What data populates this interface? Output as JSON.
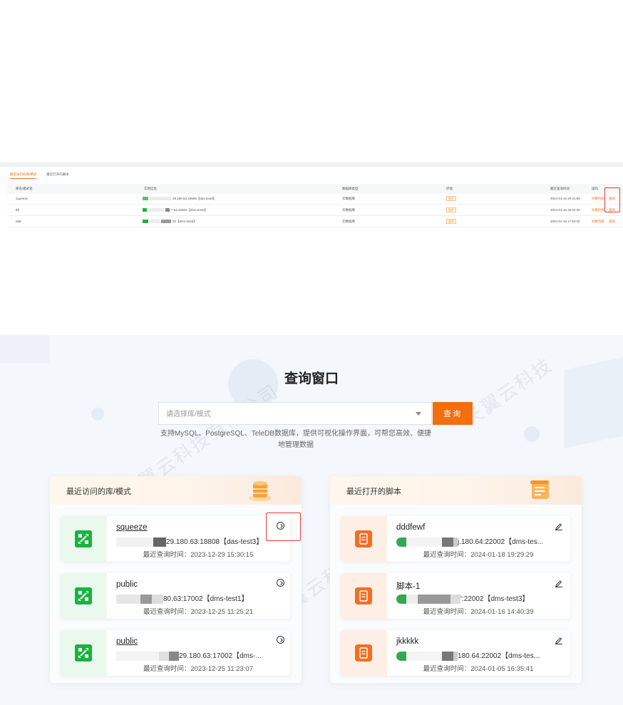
{
  "top_table": {
    "tabs": [
      "最近访问的库/模式",
      "最近打开的脚本"
    ],
    "columns": [
      "库名/模式名",
      "实例信息",
      "数据库类型",
      "环境",
      "最近查询时间",
      "操作"
    ],
    "rows": [
      {
        "name": "squeeze",
        "instance": "29.180.63:18808【das-test3】",
        "db_type": "云数据库",
        "env": "生产",
        "time": "2024-01-16 20:41:59",
        "op1": "对象列表",
        "op2": "查询"
      },
      {
        "name": "tttt",
        "instance": "7.64:22002【dms-test3】",
        "db_type": "云数据库",
        "env": "生产",
        "time": "2024-01-16 20:02:30",
        "op1": "对象列表",
        "op2": "查询"
      },
      {
        "name": "ddd",
        "instance": "02【dms-test3】",
        "db_type": "云数据库",
        "env": "生产",
        "time": "2024-01-16 17:54:30",
        "op1": "对象列表",
        "op2": "查询"
      }
    ]
  },
  "query": {
    "title": "查询窗口",
    "placeholder": "请选择库/模式",
    "button": "查询",
    "description": "支持MySQL、PostgreSQL、TeleDB数据库，提供可视化操作界面，可帮您高效、便捷地管理数据"
  },
  "recent_db": {
    "title": "最近访问的库/模式",
    "items": [
      {
        "name": "squeeze",
        "conn": "29.180.63:18808【das-test3】",
        "time": "最近查询时间：2023-12-29 15:30:15"
      },
      {
        "name": "public",
        "conn": "80.63:17002【dms-test1】",
        "time": "最近查询时间：2023-12-25 11:25:21"
      },
      {
        "name": "public",
        "conn": "29.180.63:17002【dms-...",
        "time": "最近查询时间：2023-12-25 11:23:07"
      }
    ]
  },
  "recent_scripts": {
    "title": "最近打开的脚本",
    "items": [
      {
        "name": "dddfewf",
        "conn": "j.180.64:22002【dms-tes...",
        "time": "最近查询时间：2024-01-18 19:29:29"
      },
      {
        "name": "脚本-1",
        "conn": "':22002【dms-test3】",
        "time": "最近查询时间：2024-01-16 14:40:39"
      },
      {
        "name": "jkkkkk",
        "conn": "180.64:22002【dms-tes...",
        "time": "最近查询时间：2024-01-05 16:35:41"
      }
    ]
  },
  "icons": {
    "db": "database-icon",
    "script": "script-file-icon",
    "open": "arrow-circle-icon",
    "edit": "edit-pencil-icon"
  },
  "colors": {
    "accent": "#f26f0f",
    "green": "#18b43d",
    "highlight": "#e23b3b"
  }
}
